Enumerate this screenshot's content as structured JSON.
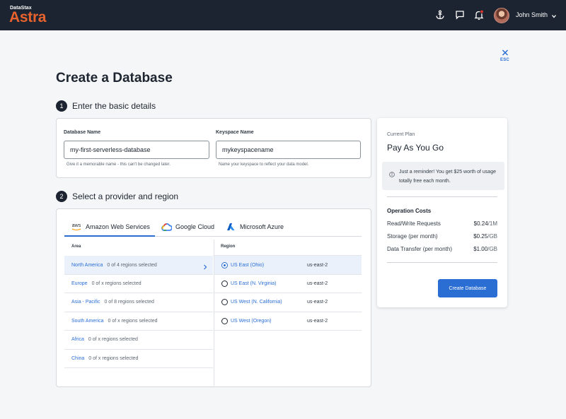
{
  "topbar": {
    "brand_small": "DataStax",
    "brand_big": "Astra",
    "username": "John Smith",
    "icons": [
      "anchor-icon",
      "chat-icon",
      "bell-icon",
      "chevron-down-icon"
    ]
  },
  "close": {
    "label": "ESC"
  },
  "page_title": "Create a Database",
  "step1": {
    "number": "1",
    "title": "Enter the basic details",
    "db_name_label": "Database Name",
    "db_name_value": "my-first-serverless-database",
    "db_name_help": "Give it a memorable name - this can't be changed later.",
    "keyspace_label": "Keyspace Name",
    "keyspace_value": "mykeyspacename",
    "keyspace_help": "Name your keyspace to reflect your data model."
  },
  "step2": {
    "number": "2",
    "title": "Select a provider and region",
    "providers": [
      {
        "label": "Amazon Web Services",
        "icon_text": "aws",
        "selected": true
      },
      {
        "label": "Google Cloud",
        "selected": false
      },
      {
        "label": "Microsoft Azure",
        "selected": false
      }
    ],
    "area_header": "Area",
    "region_header": "Region",
    "areas": [
      {
        "name": "North America",
        "count": "0 of 4 regions selected",
        "selected": true
      },
      {
        "name": "Europe",
        "count": "0 of x regions selected",
        "selected": false
      },
      {
        "name": "Asia - Pacific",
        "count": "0 of 8 regions selected",
        "selected": false
      },
      {
        "name": "South America",
        "count": "0 of x regions selected",
        "selected": false
      },
      {
        "name": "Africa",
        "count": "0 of x regions selected",
        "selected": false
      },
      {
        "name": "China",
        "count": "0 of x regions selected",
        "selected": false
      }
    ],
    "regions": [
      {
        "name": "US East (Ohio)",
        "code": "us-east-2",
        "selected": true
      },
      {
        "name": "US East (N. Virginia)",
        "code": "us-east-2",
        "selected": false
      },
      {
        "name": "US West (N. California)",
        "code": "us-east-2",
        "selected": false
      },
      {
        "name": "US West (Oregon)",
        "code": "us-east-2",
        "selected": false
      }
    ]
  },
  "plan": {
    "label": "Current Plan",
    "name": "Pay As You Go",
    "notice": "Just a reminder! You get $25 worth of usage totally free each month.",
    "costs_title": "Operation Costs",
    "costs": [
      {
        "label": "Read/Write Requests",
        "price": "$0.24",
        "unit": "/1M"
      },
      {
        "label": "Storage (per month)",
        "price": "$0.25",
        "unit": "/GB"
      },
      {
        "label": "Data Transfer (per month)",
        "price": "$1.00",
        "unit": "/GB"
      }
    ],
    "button": "Create Database"
  },
  "colors": {
    "accent": "#2b6ed3",
    "brand": "#e8622e",
    "topbar": "#1d2431"
  }
}
